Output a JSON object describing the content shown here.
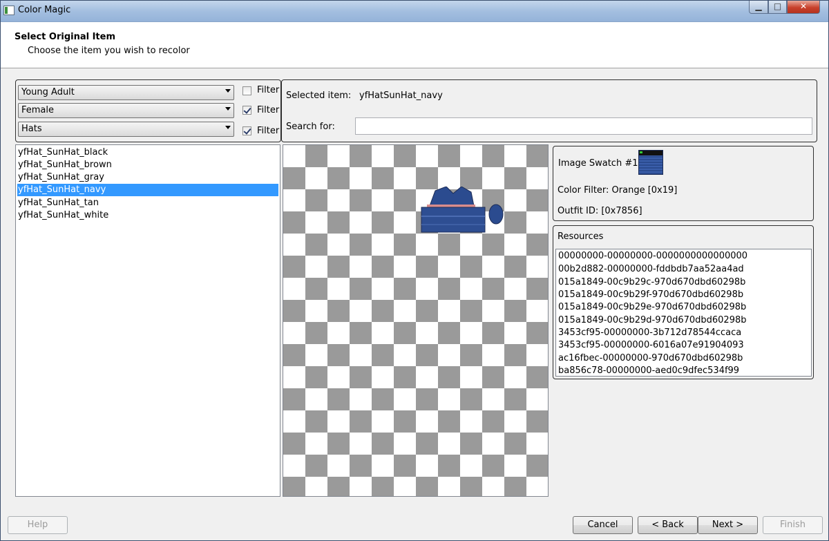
{
  "window": {
    "title": "Color Magic",
    "minimize": "▁",
    "maximize": "□",
    "close": "✕",
    "icon": "app-icon"
  },
  "header": {
    "title": "Select Original Item",
    "subtitle": "Choose the item you wish to recolor"
  },
  "filters": [
    {
      "value": "Young Adult",
      "filter_label": "Filter",
      "checked": false
    },
    {
      "value": "Female",
      "filter_label": "Filter",
      "checked": true
    },
    {
      "value": "Hats",
      "filter_label": "Filter",
      "checked": true
    }
  ],
  "items": [
    {
      "label": "yfHat_SunHat_black",
      "selected": false
    },
    {
      "label": "yfHat_SunHat_brown",
      "selected": false
    },
    {
      "label": "yfHat_SunHat_gray",
      "selected": false
    },
    {
      "label": "yfHat_SunHat_navy",
      "selected": true
    },
    {
      "label": "yfHat_SunHat_tan",
      "selected": false
    },
    {
      "label": "yfHat_SunHat_white",
      "selected": false
    }
  ],
  "selection": {
    "selected_label": "Selected item:",
    "selected_value": "yfHatSunHat_navy",
    "search_label": "Search for:",
    "search_value": ""
  },
  "info": {
    "swatch_label": "Image Swatch #1",
    "color_filter": "Color Filter: Orange [0x19]",
    "outfit_id": "Outfit ID: [0x7856]"
  },
  "resources": {
    "title": "Resources",
    "items": [
      "00000000-00000000-0000000000000000",
      "00b2d882-00000000-fddbdb7aa52aa4ad",
      "015a1849-00c9b29c-970d670dbd60298b",
      "015a1849-00c9b29f-970d670dbd60298b",
      "015a1849-00c9b29e-970d670dbd60298b",
      "015a1849-00c9b29d-970d670dbd60298b",
      "3453cf95-00000000-3b712d78544ccaca",
      "3453cf95-00000000-6016a07e91904093",
      "ac16fbec-00000000-970d670dbd60298b",
      "ba856c78-00000000-aed0c9dfec534f99"
    ]
  },
  "buttons": {
    "help": "Help",
    "cancel": "Cancel",
    "back": "< Back",
    "next": "Next >",
    "finish": "Finish"
  },
  "colors": {
    "selection": "#3399ff",
    "hat": "#2b4b8f",
    "hat_band": "#d98c8c"
  }
}
